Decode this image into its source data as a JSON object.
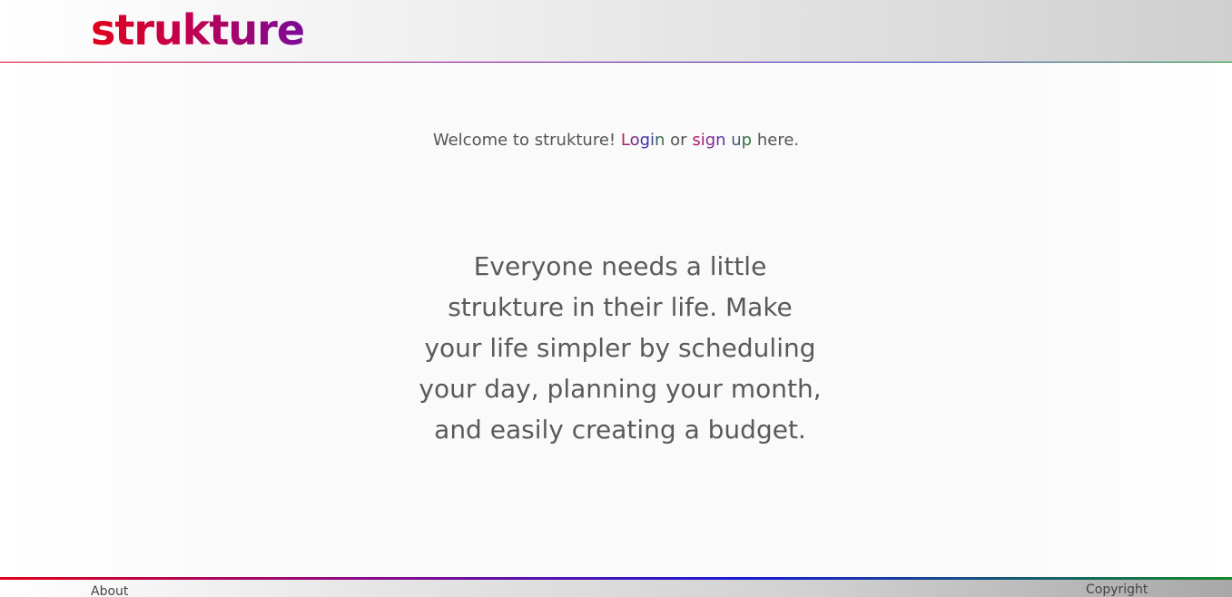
{
  "header": {
    "logo_text": "strukture"
  },
  "main": {
    "welcome": {
      "prefix": "Welcome to strukture!",
      "login_label": "Login",
      "or_text": "or",
      "signup_label": "sign up",
      "suffix": "here."
    },
    "tagline": "Everyone needs a little strukture in their life. Make your life simpler by scheduling your day, planning your month, and easily creating a budget."
  },
  "footer": {
    "about_label": "About",
    "copyright_text": "Copyright"
  },
  "colors": {
    "brand_red": "#e0001b",
    "brand_purple": "#7a0a9a",
    "brand_blue": "#2a2fb5",
    "brand_green": "#138a2a",
    "text_gray": "#555555"
  }
}
